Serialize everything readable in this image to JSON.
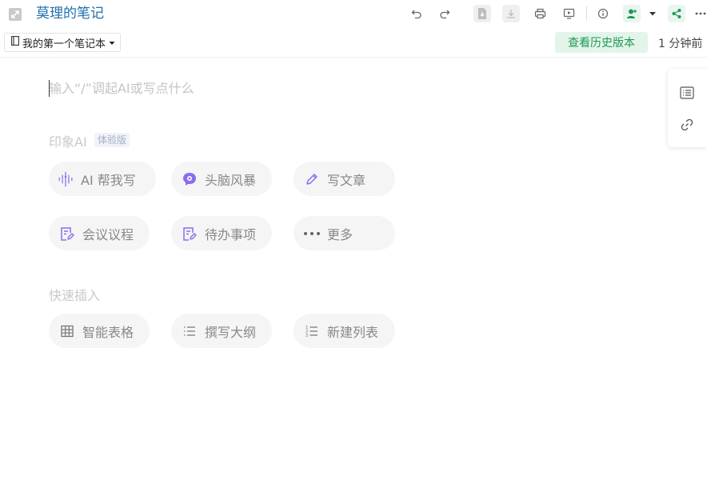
{
  "header": {
    "title": "莫理的笔记",
    "notebook": "我的第一个笔记本",
    "history_button": "查看历史版本",
    "saved_time": "1 分钟前"
  },
  "editor": {
    "placeholder": "输入“/”调起AI或写点什么"
  },
  "ai_section": {
    "label": "印象AI",
    "badge": "体验版",
    "actions": [
      {
        "label": "AI 帮我写",
        "icon": "sparkle-icon"
      },
      {
        "label": "头脑风暴",
        "icon": "brain-icon"
      },
      {
        "label": "写文章",
        "icon": "pencil-icon"
      },
      {
        "label": "会议议程",
        "icon": "edit-doc-icon"
      },
      {
        "label": "待办事项",
        "icon": "edit-doc-icon"
      },
      {
        "label": "更多",
        "icon": "more-dots-icon"
      }
    ]
  },
  "quick_insert": {
    "label": "快速插入",
    "actions": [
      {
        "label": "智能表格",
        "icon": "table-icon"
      },
      {
        "label": "撰写大纲",
        "icon": "list-icon"
      },
      {
        "label": "新建列表",
        "icon": "numbered-list-icon"
      }
    ]
  },
  "colors": {
    "accent_green": "#1e9a55",
    "title_blue": "#1d6fae",
    "ai_purple": "#8b6cf0"
  }
}
